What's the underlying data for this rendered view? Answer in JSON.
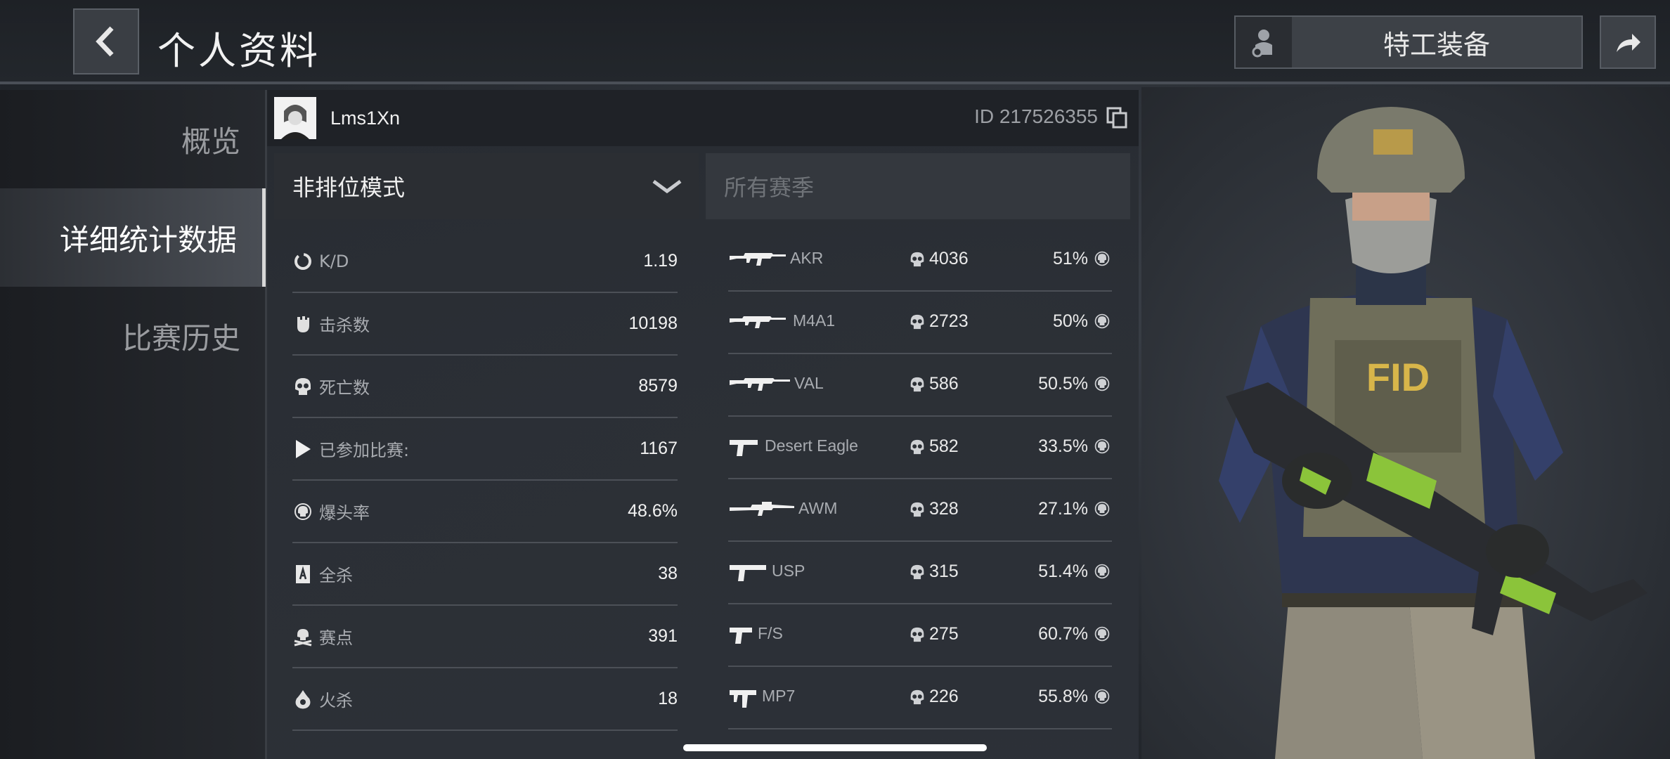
{
  "header": {
    "title": "个人资料",
    "agent_button_label": "特工装备"
  },
  "sidebar": {
    "items": [
      {
        "label": "概览",
        "active": false
      },
      {
        "label": "详细统计数据",
        "active": true
      },
      {
        "label": "比赛历史",
        "active": false
      }
    ]
  },
  "profile": {
    "username": "Lms1Xn",
    "id_text": "ID 217526355"
  },
  "filters": {
    "mode": "非排位模式",
    "season": "所有赛季"
  },
  "stats": [
    {
      "icon": "kd-icon",
      "label": "K/D",
      "value": "1.19"
    },
    {
      "icon": "fist-icon",
      "label": "击杀数",
      "value": "10198"
    },
    {
      "icon": "skull-icon",
      "label": "死亡数",
      "value": "8579"
    },
    {
      "icon": "play-icon",
      "label": "已参加比赛:",
      "value": "1167"
    },
    {
      "icon": "headshot-icon",
      "label": "爆头率",
      "value": "48.6%"
    },
    {
      "icon": "ace-card-icon",
      "label": "全杀",
      "value": "38"
    },
    {
      "icon": "match-point-icon",
      "label": "赛点",
      "value": "391"
    },
    {
      "icon": "fire-kill-icon",
      "label": "火杀",
      "value": "18"
    }
  ],
  "weapons": [
    {
      "name": "AKR",
      "kills": "4036",
      "headshot": "51%"
    },
    {
      "name": "M4A1",
      "kills": "2723",
      "headshot": "50%"
    },
    {
      "name": "VAL",
      "kills": "586",
      "headshot": "50.5%"
    },
    {
      "name": "Desert Eagle",
      "kills": "582",
      "headshot": "33.5%"
    },
    {
      "name": "AWM",
      "kills": "328",
      "headshot": "27.1%"
    },
    {
      "name": "USP",
      "kills": "315",
      "headshot": "51.4%"
    },
    {
      "name": "F/S",
      "kills": "275",
      "headshot": "60.7%"
    },
    {
      "name": "MP7",
      "kills": "226",
      "headshot": "55.8%"
    }
  ],
  "character": {
    "vest_text": "FID"
  }
}
